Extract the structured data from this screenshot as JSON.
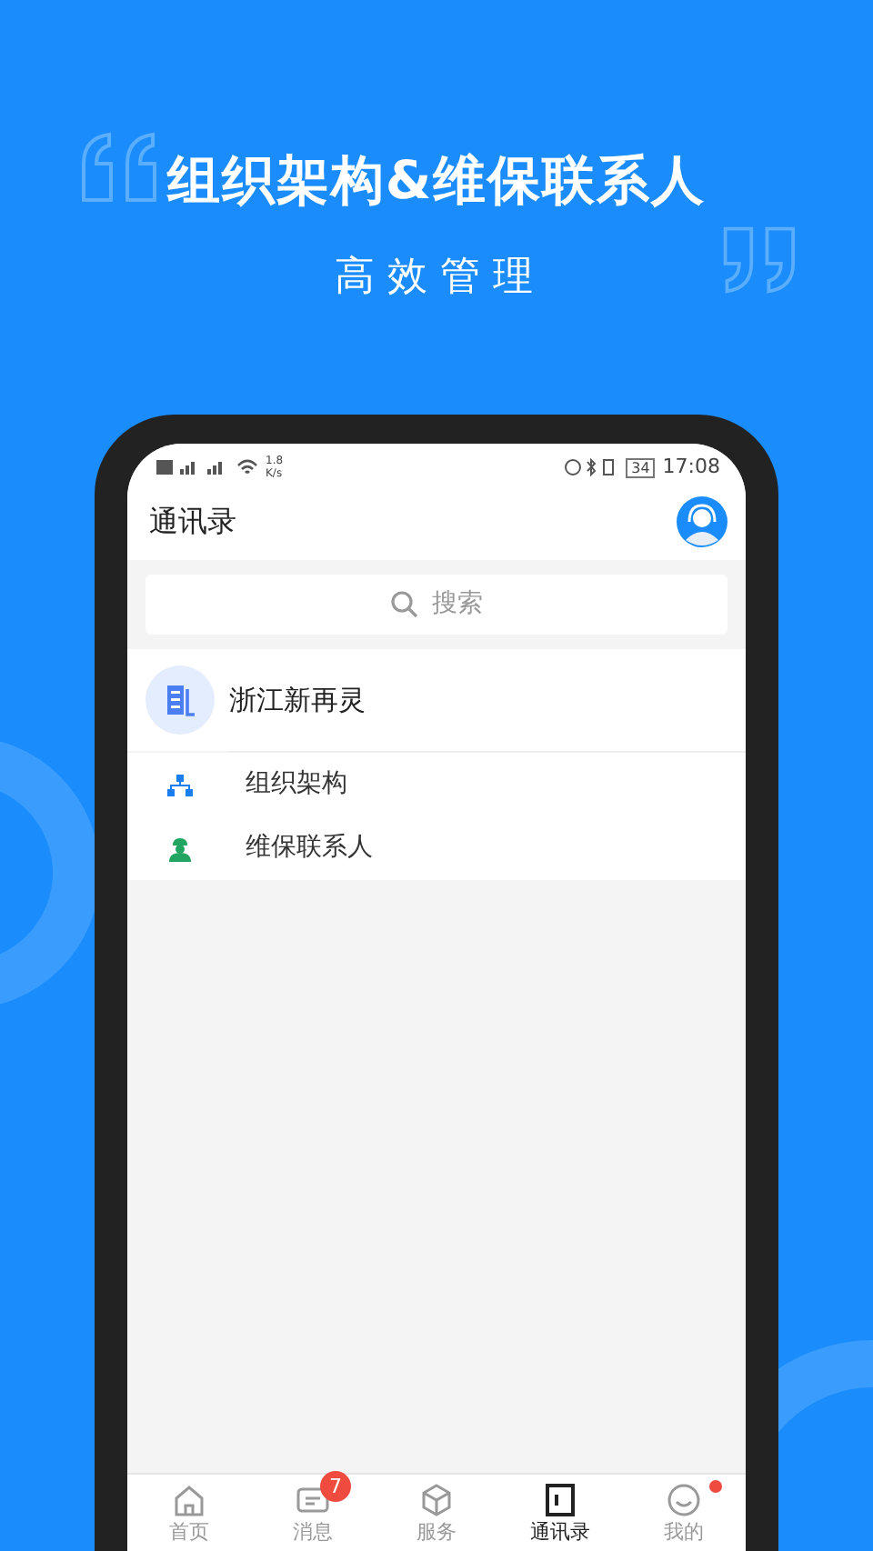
{
  "banner": {
    "title": "组织架构&维保联系人",
    "subtitle": "高 效 管 理"
  },
  "status_bar": {
    "speed": "1.8",
    "speed_unit": "K/s",
    "battery": "34",
    "time": "17:08"
  },
  "header": {
    "title": "通讯录"
  },
  "search": {
    "placeholder": "搜索"
  },
  "company": {
    "name": "浙江新再灵"
  },
  "entries": [
    {
      "kind": "org",
      "label": "组织架构"
    },
    {
      "kind": "contact",
      "label": "维保联系人"
    }
  ],
  "tabs": [
    {
      "kind": "home",
      "label": "首页",
      "selected": false
    },
    {
      "kind": "message",
      "label": "消息",
      "selected": false,
      "badge": "7"
    },
    {
      "kind": "service",
      "label": "服务",
      "selected": false
    },
    {
      "kind": "contacts",
      "label": "通讯录",
      "selected": true
    },
    {
      "kind": "me",
      "label": "我的",
      "selected": false,
      "dot": true
    }
  ]
}
